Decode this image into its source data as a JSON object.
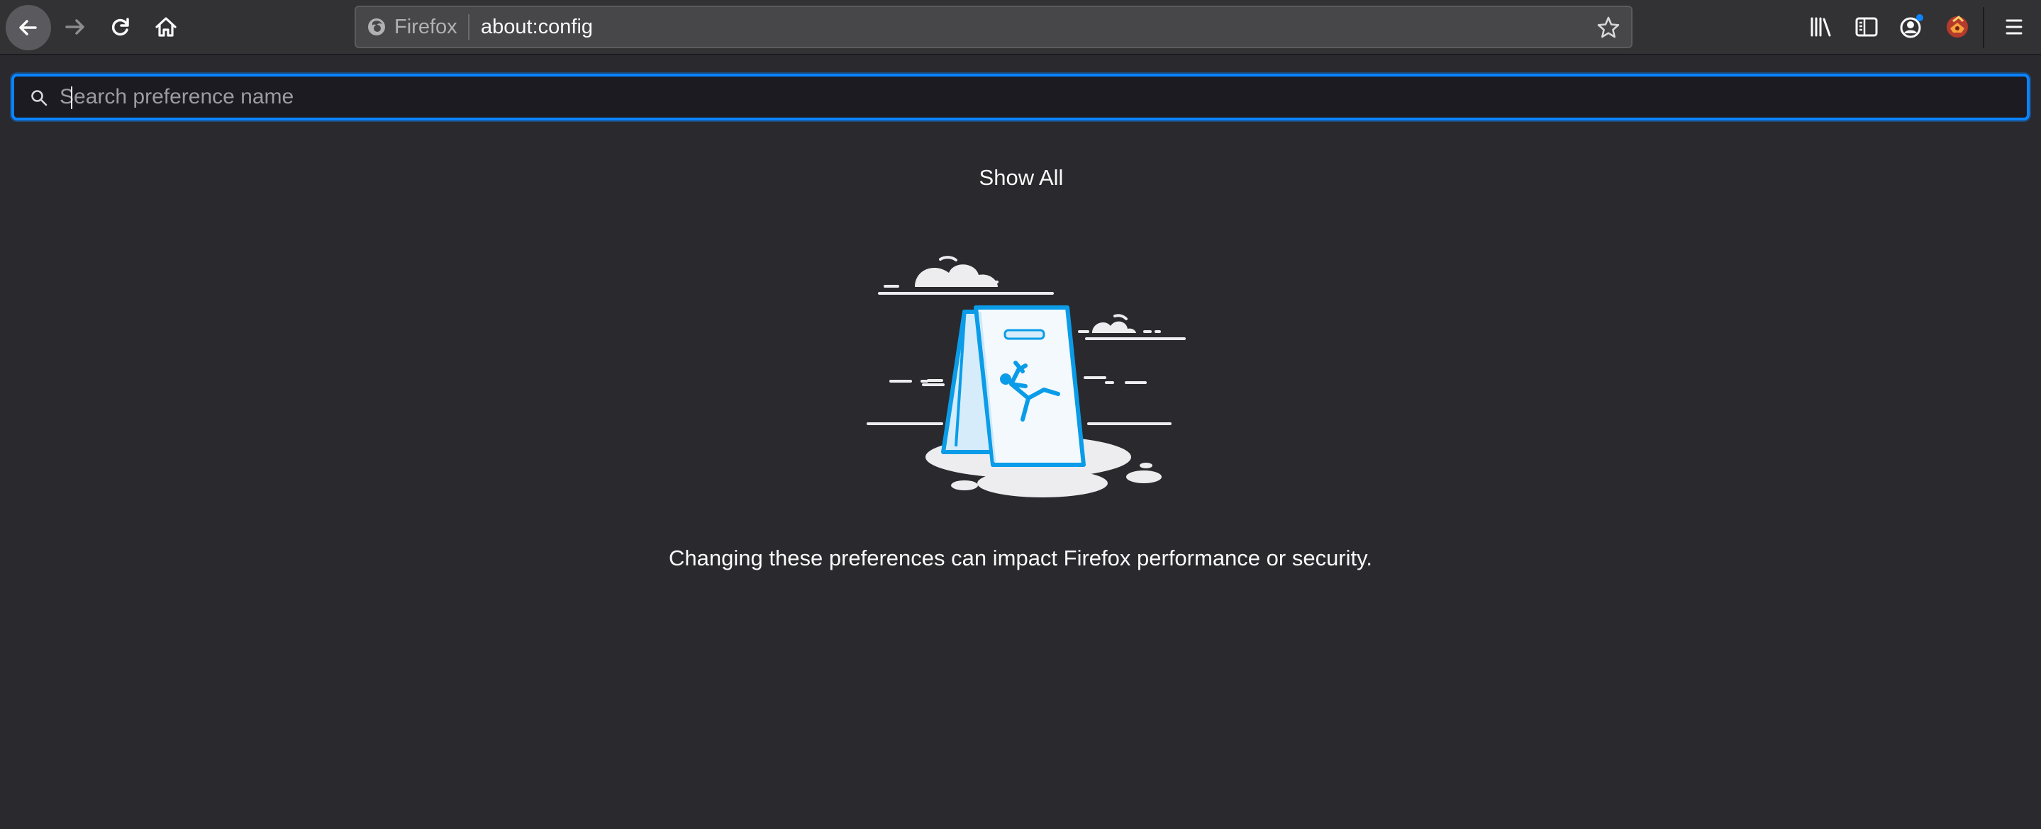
{
  "toolbar": {
    "identity_label": "Firefox",
    "url": "about:config",
    "icons": {
      "back": "arrow-left-icon",
      "forward": "arrow-right-icon",
      "reload": "reload-icon",
      "home": "home-icon",
      "bookmark": "star-icon",
      "library": "library-icon",
      "sidebar": "sidebar-icon",
      "account": "account-icon",
      "extension": "extension-icon",
      "menu": "hamburger-menu-icon"
    }
  },
  "search": {
    "placeholder": "Search preference name",
    "value": ""
  },
  "main": {
    "show_all_label": "Show All",
    "warning_text": "Changing these preferences can impact Firefox performance or security."
  },
  "colors": {
    "background": "#2a2a2e",
    "toolbar": "#323234",
    "urlbar": "#474749",
    "accent": "#0a84ff",
    "illustration_blue": "#0a9ce8",
    "text": "#f9f9fa"
  }
}
